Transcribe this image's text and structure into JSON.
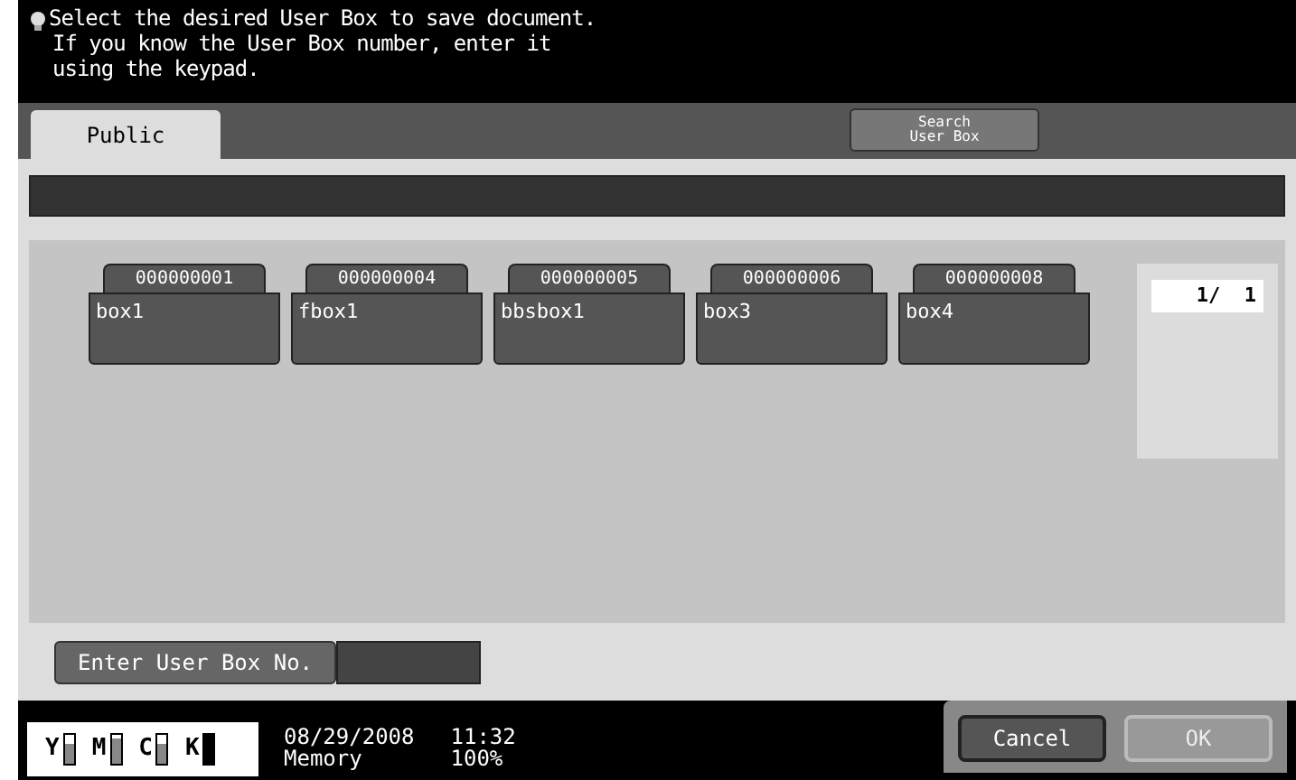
{
  "message": [
    "Select the desired User Box to save document.",
    "If you know the User Box number, enter it",
    "using the keypad."
  ],
  "tabs": [
    {
      "label": "Public",
      "selected": true
    }
  ],
  "search_button": {
    "label": "Search\nUser Box"
  },
  "boxes": [
    {
      "number": "000000001",
      "name": "box1"
    },
    {
      "number": "000000004",
      "name": "fbox1"
    },
    {
      "number": "000000005",
      "name": "bbsbox1"
    },
    {
      "number": "000000006",
      "name": "box3"
    },
    {
      "number": "000000008",
      "name": "box4"
    }
  ],
  "page_indicator": "1/  1",
  "enter_button": {
    "label": "Enter User Box No."
  },
  "toner": [
    {
      "label": "Y",
      "level": 0.7
    },
    {
      "label": "M",
      "level": 0.85
    },
    {
      "label": "C",
      "level": 0.7
    },
    {
      "label": "K",
      "level": 1
    }
  ],
  "status": {
    "date": "08/29/2008",
    "time": "11:32",
    "memory_label": "Memory",
    "memory_value": "100%"
  },
  "buttons": [
    {
      "label": "Cancel",
      "disabled": false
    },
    {
      "label": "OK",
      "disabled": true
    }
  ]
}
